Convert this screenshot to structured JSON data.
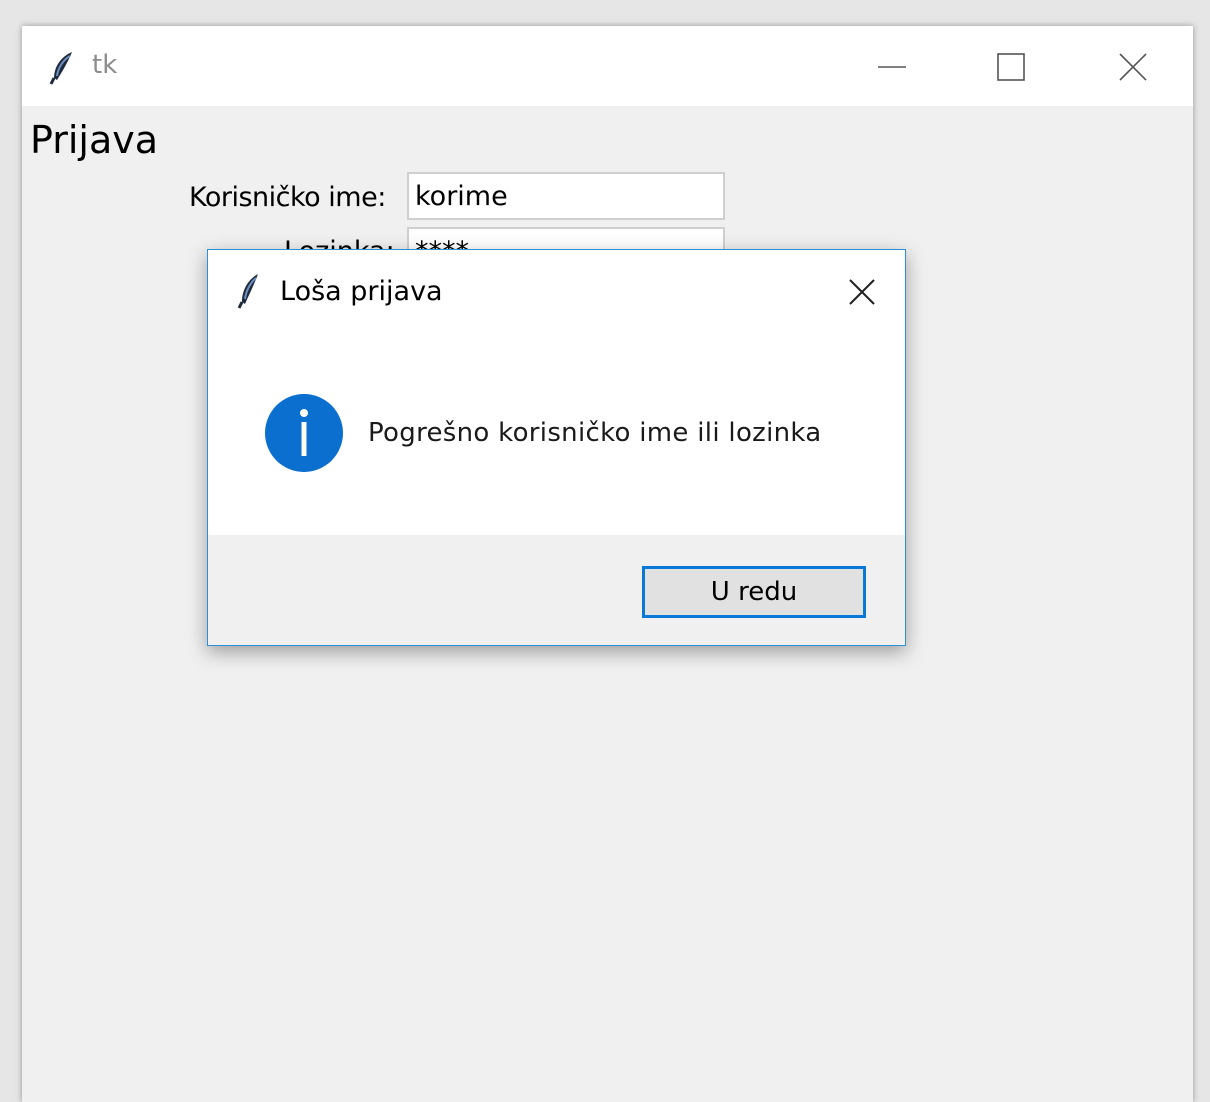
{
  "main_window": {
    "title": "tk",
    "icon": "feather-icon",
    "controls": {
      "minimize": "minimize-icon",
      "maximize": "maximize-icon",
      "close": "close-icon"
    }
  },
  "form": {
    "heading": "Prijava",
    "username_label": "Korisničko ime:",
    "username_value": "korime",
    "password_label": "Lozinka:",
    "password_value": "****"
  },
  "dialog": {
    "title": "Loša prijava",
    "icon": "feather-icon",
    "info_icon": "info-icon",
    "message": "Pogrešno korisničko ime ili lozinka",
    "ok_label": "U redu"
  },
  "colors": {
    "accent": "#0a78d7",
    "dialog_border": "#2b90d9",
    "info_icon": "#0a6fce",
    "window_bg": "#f0f0f0"
  }
}
